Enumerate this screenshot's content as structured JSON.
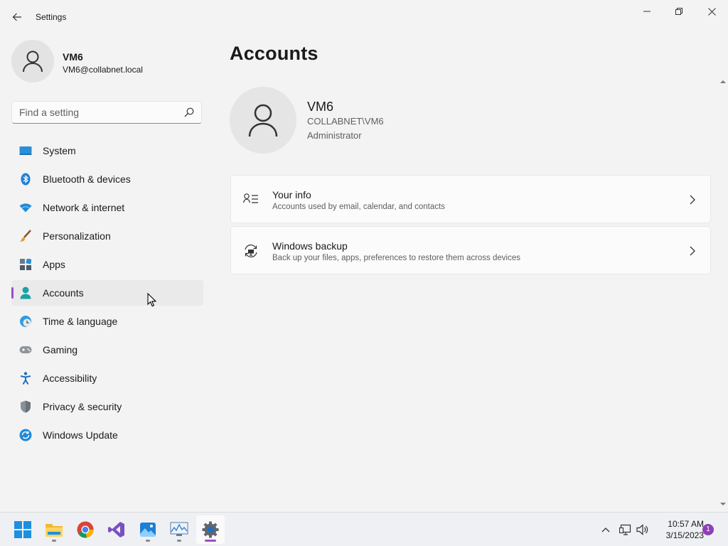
{
  "window": {
    "title": "Settings"
  },
  "profile": {
    "name": "VM6",
    "email": "VM6@collabnet.local"
  },
  "search": {
    "placeholder": "Find a setting"
  },
  "nav": {
    "selected": "Accounts",
    "items": [
      {
        "label": "System",
        "icon": "system-icon"
      },
      {
        "label": "Bluetooth & devices",
        "icon": "bluetooth-icon"
      },
      {
        "label": "Network & internet",
        "icon": "wifi-icon"
      },
      {
        "label": "Personalization",
        "icon": "paintbrush-icon"
      },
      {
        "label": "Apps",
        "icon": "apps-icon"
      },
      {
        "label": "Accounts",
        "icon": "accounts-icon"
      },
      {
        "label": "Time & language",
        "icon": "clock-globe-icon"
      },
      {
        "label": "Gaming",
        "icon": "gamepad-icon"
      },
      {
        "label": "Accessibility",
        "icon": "accessibility-icon"
      },
      {
        "label": "Privacy & security",
        "icon": "shield-icon"
      },
      {
        "label": "Windows Update",
        "icon": "update-icon"
      }
    ]
  },
  "main": {
    "title": "Accounts",
    "user": {
      "name": "VM6",
      "domain": "COLLABNET\\VM6",
      "role": "Administrator"
    },
    "cards": [
      {
        "title": "Your info",
        "subtitle": "Accounts used by email, calendar, and contacts",
        "icon": "person-list-icon"
      },
      {
        "title": "Windows backup",
        "subtitle": "Back up your files, apps, preferences to restore them across devices",
        "icon": "backup-icon"
      }
    ]
  },
  "taskbar": {
    "apps": [
      "start-icon",
      "file-explorer-icon",
      "chrome-icon",
      "visual-studio-icon",
      "photos-icon",
      "resource-monitor-icon",
      "settings-icon"
    ],
    "clock": {
      "time": "10:57 AM",
      "date": "3/15/2023"
    },
    "notification_count": "1"
  },
  "colors": {
    "accent": "#9a4fc4",
    "background": "#f3f3f3",
    "card": "#fbfbfb"
  }
}
